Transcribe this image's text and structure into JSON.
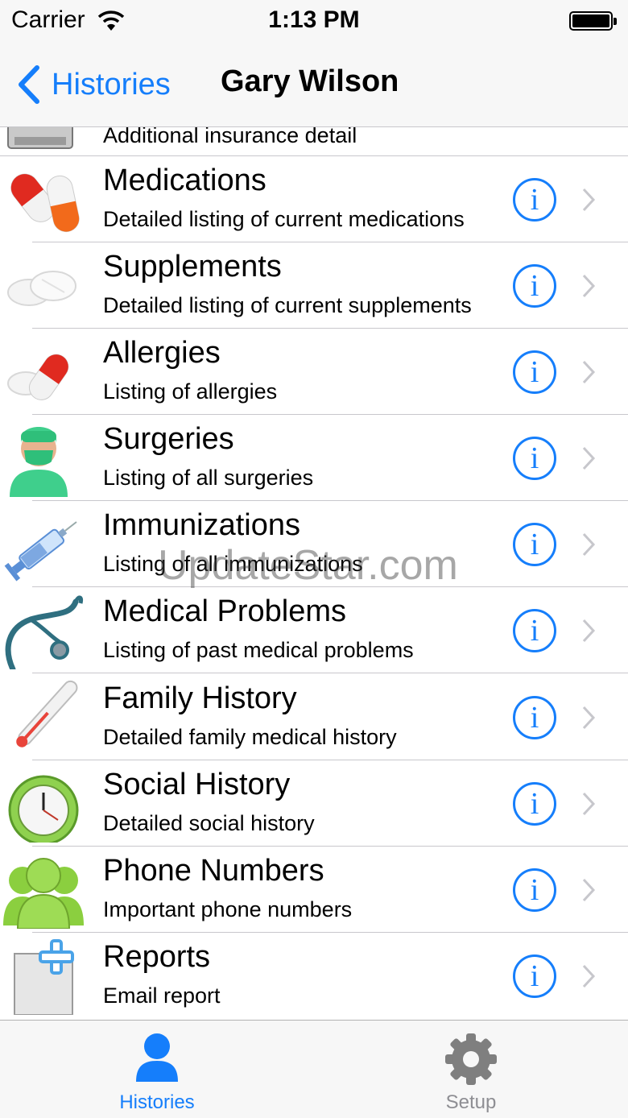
{
  "status": {
    "carrier": "Carrier",
    "time": "1:13 PM"
  },
  "nav": {
    "back_label": "Histories",
    "title": "Gary Wilson"
  },
  "partial_row": {
    "subtitle": "Additional insurance detail"
  },
  "rows": [
    {
      "icon": "pills-icon",
      "title": "Medications",
      "subtitle": "Detailed listing of current medications"
    },
    {
      "icon": "supplement-tablets-icon",
      "title": "Supplements",
      "subtitle": "Detailed listing of current supplements"
    },
    {
      "icon": "allergy-pills-icon",
      "title": "Allergies",
      "subtitle": "Listing of allergies"
    },
    {
      "icon": "surgeon-icon",
      "title": "Surgeries",
      "subtitle": "Listing of all surgeries"
    },
    {
      "icon": "syringe-icon",
      "title": "Immunizations",
      "subtitle": "Listing of all immunizations"
    },
    {
      "icon": "stethoscope-icon",
      "title": "Medical Problems",
      "subtitle": "Listing of past medical problems"
    },
    {
      "icon": "thermometer-icon",
      "title": "Family History",
      "subtitle": "Detailed family medical history"
    },
    {
      "icon": "clock-icon",
      "title": "Social History",
      "subtitle": "Detailed social history"
    },
    {
      "icon": "people-icon",
      "title": "Phone Numbers",
      "subtitle": "Important phone numbers"
    },
    {
      "icon": "report-plus-icon",
      "title": "Reports",
      "subtitle": "Email report"
    }
  ],
  "info_glyph": "i",
  "watermark": "UpdateStar.com",
  "tabs": [
    {
      "label": "Histories",
      "icon": "person-icon",
      "active": true
    },
    {
      "label": "Setup",
      "icon": "gear-icon",
      "active": false
    }
  ],
  "colors": {
    "accent": "#157efb",
    "separator": "#c8c7cc",
    "bar_bg": "#f7f7f7",
    "inactive": "#8e8e93"
  }
}
